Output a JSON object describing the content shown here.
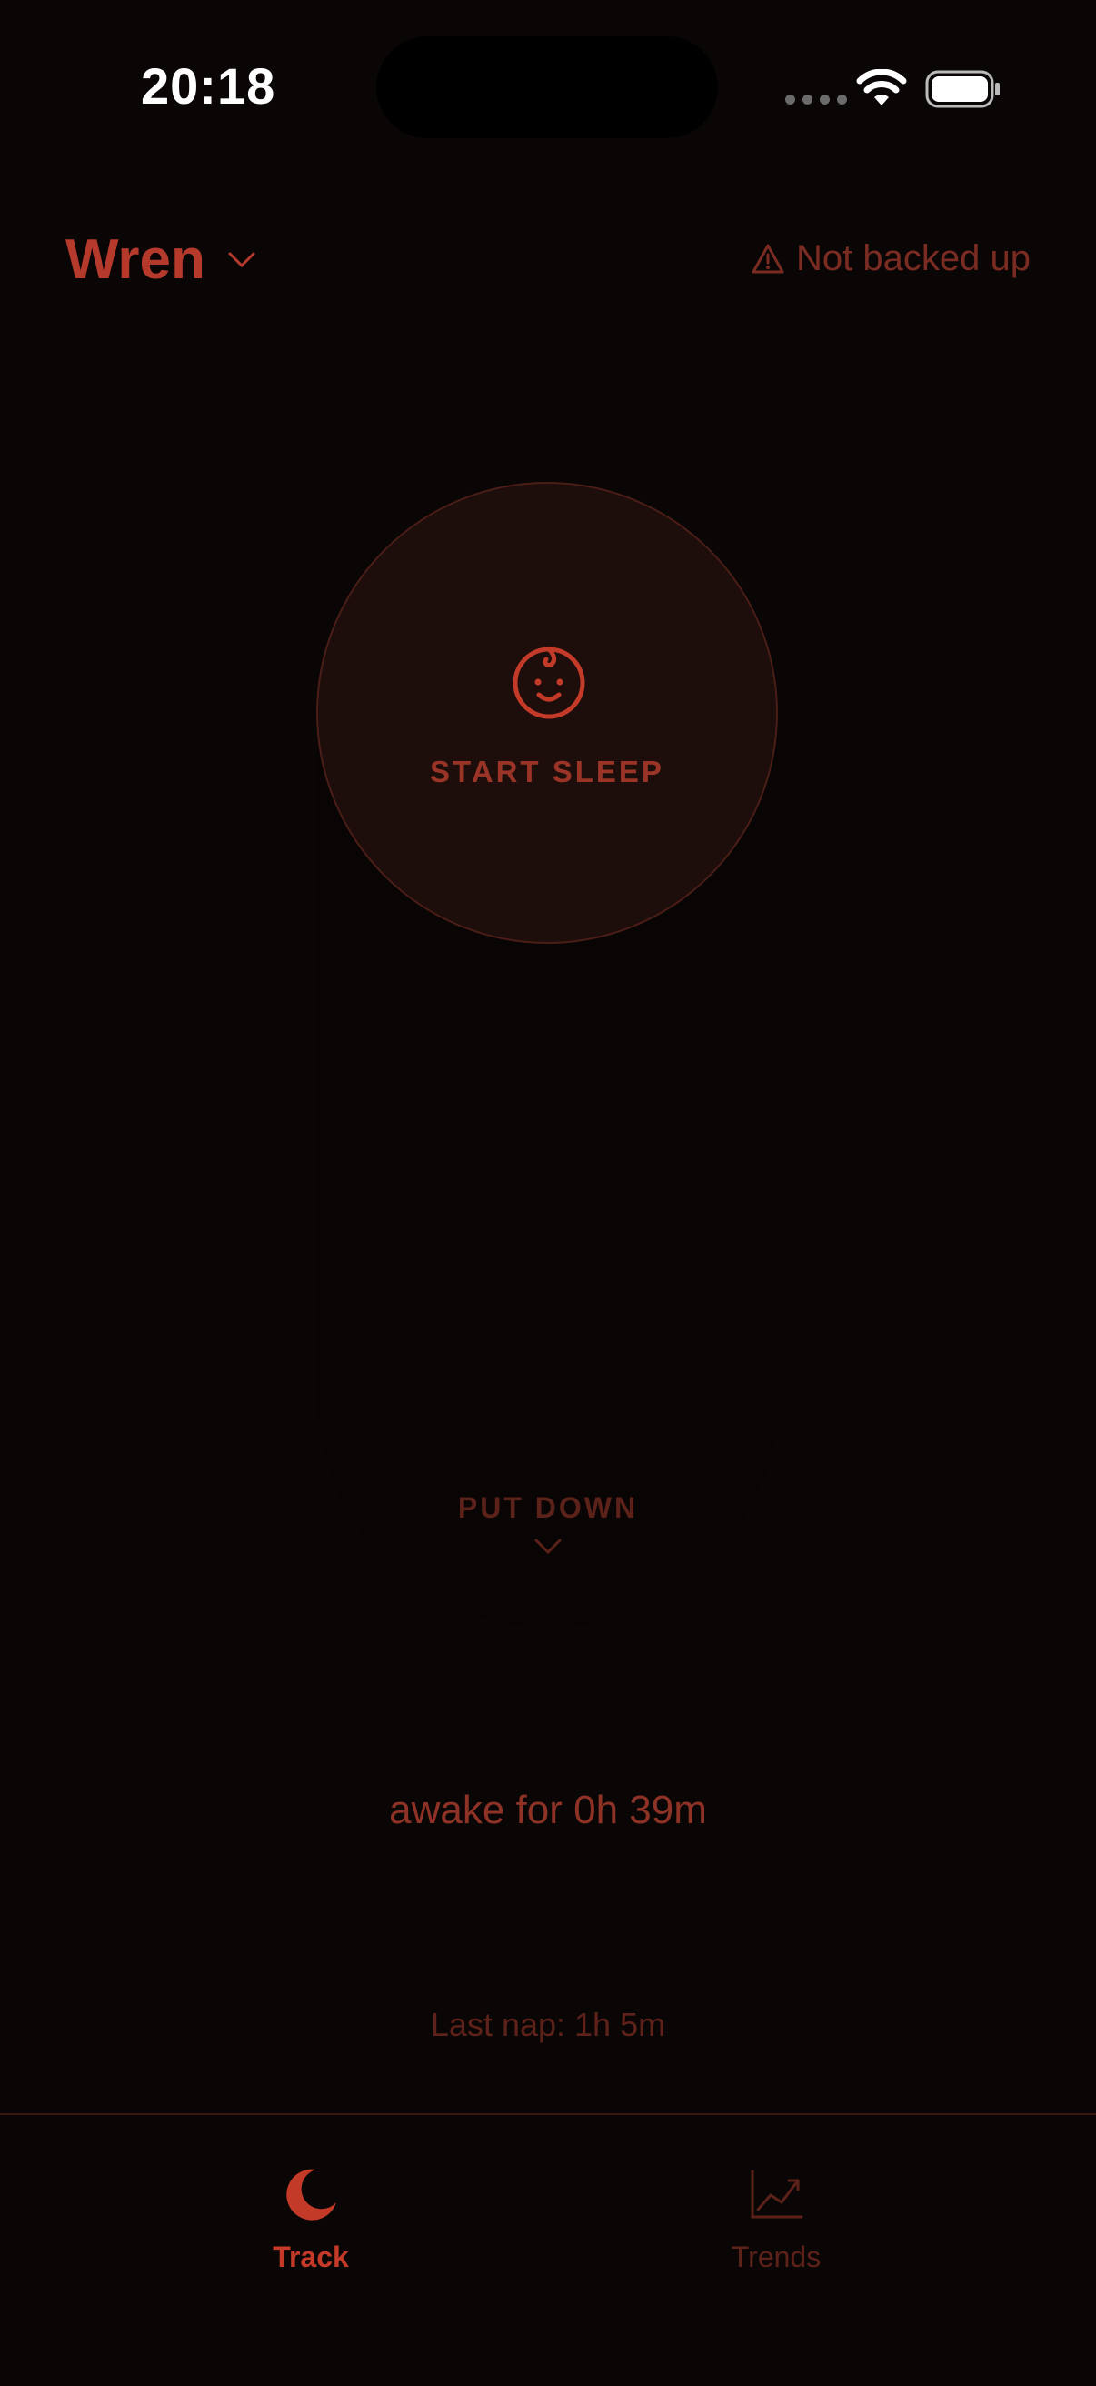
{
  "status_bar": {
    "time": "20:18"
  },
  "header": {
    "child_name": "Wren",
    "backup_status": "Not backed up"
  },
  "tracker": {
    "start_label": "START SLEEP",
    "put_down_label": "PUT DOWN"
  },
  "summary": {
    "awake_text": "awake for 0h 39m",
    "last_nap": "Last nap: 1h 5m"
  },
  "tabs": [
    {
      "label": "Track",
      "icon": "moon-icon",
      "active": true
    },
    {
      "label": "Trends",
      "icon": "chart-icon",
      "active": false
    }
  ],
  "colors": {
    "background": "#0b0606",
    "accent": "#c43a28",
    "muted": "#5c2119"
  }
}
